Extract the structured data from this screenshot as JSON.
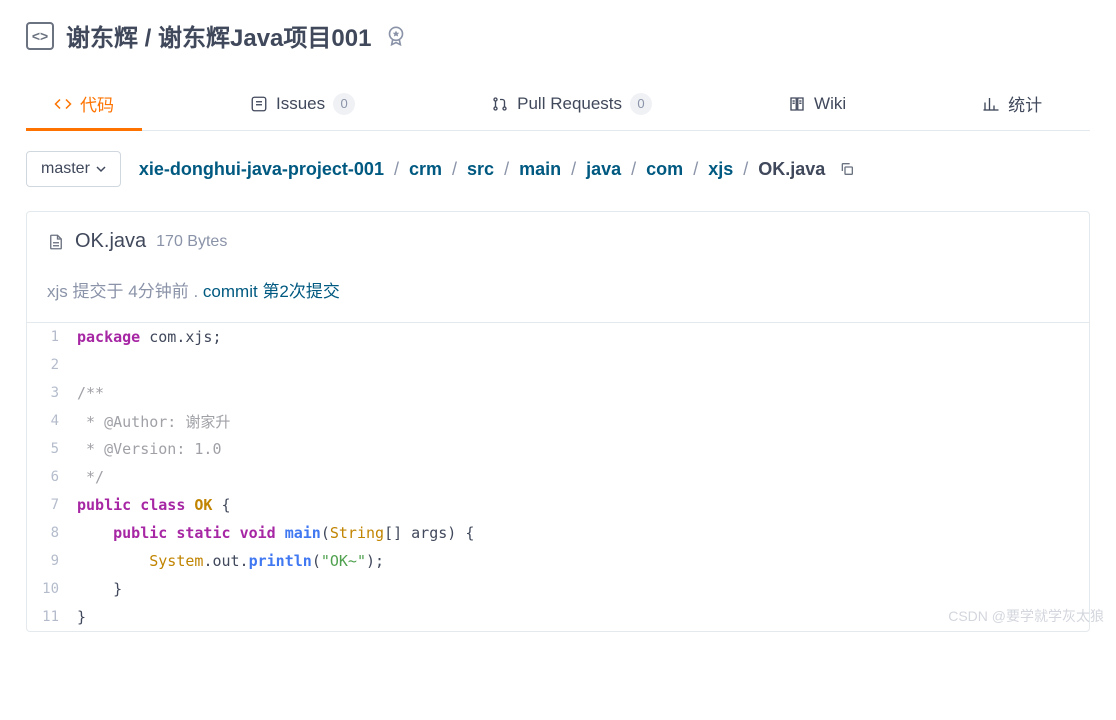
{
  "repo": {
    "owner": "谢东辉",
    "name": "谢东辉Java项目001"
  },
  "tabs": {
    "code": "代码",
    "issues": "Issues",
    "issues_count": "0",
    "prs": "Pull Requests",
    "prs_count": "0",
    "wiki": "Wiki",
    "stats": "统计"
  },
  "branch": "master",
  "breadcrumb": {
    "root": "xie-donghui-java-project-001",
    "p1": "crm",
    "p2": "src",
    "p3": "main",
    "p4": "java",
    "p5": "com",
    "p6": "xjs",
    "file": "OK.java"
  },
  "file": {
    "name": "OK.java",
    "size": "170 Bytes"
  },
  "commit": {
    "author": "xjs",
    "submitted": "提交于",
    "time": "4分钟前",
    "dot": ".",
    "label": "commit",
    "msg": "第2次提交"
  },
  "code": {
    "l1_kw": "package",
    "l1_rest": " com.xjs;",
    "l3": "/**",
    "l4": " * @Author: 谢家升",
    "l5": " * @Version: 1.0",
    "l6": " */",
    "l7_kw1": "public",
    "l7_kw2": "class",
    "l7_cls": "OK",
    "l7_end": " {",
    "l8_indent": "    ",
    "l8_kw1": "public",
    "l8_kw2": "static",
    "l8_kw3": "void",
    "l8_fn": "main",
    "l8_p1": "(",
    "l8_typ": "String",
    "l8_arr": "[] args",
    "l8_p2": ") {",
    "l9_indent": "        ",
    "l9_sys": "System",
    "l9_out": ".out.",
    "l9_fn": "println",
    "l9_p1": "(",
    "l9_str": "\"OK~\"",
    "l9_p2": ");",
    "l10": "    }",
    "l11": "}"
  },
  "watermark": "CSDN @要学就学灰太狼"
}
